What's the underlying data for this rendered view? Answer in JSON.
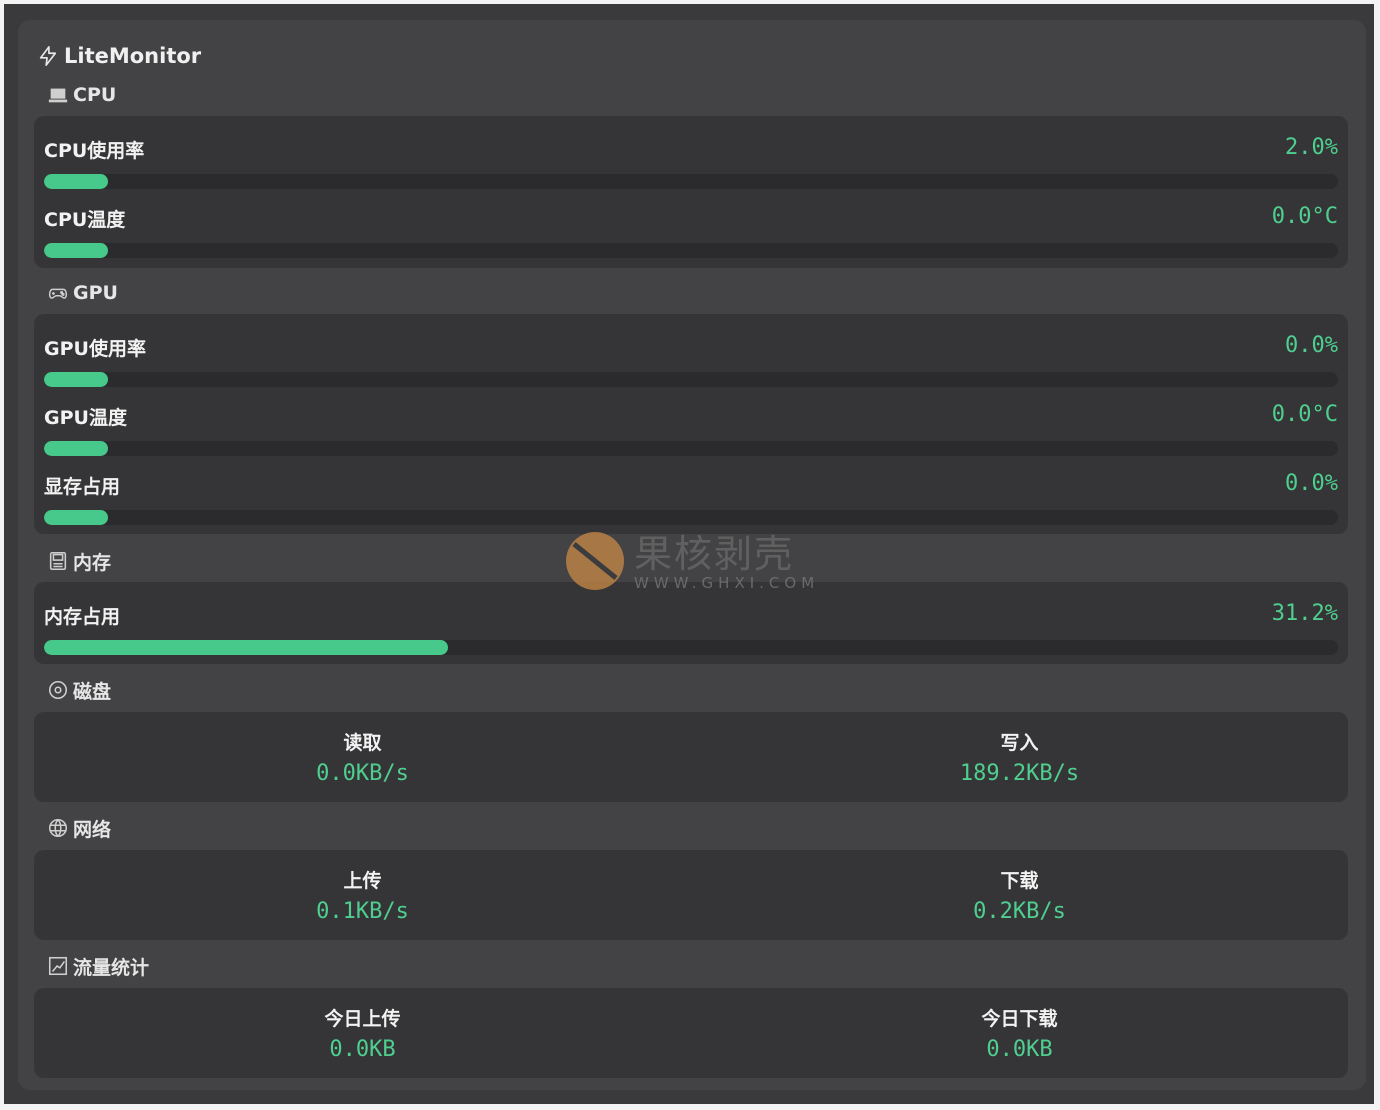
{
  "app": {
    "title": "LiteMonitor",
    "icon": "lightning-icon",
    "accent": "#46c98a"
  },
  "sections": {
    "cpu": {
      "title": "CPU",
      "icon": "laptop-icon",
      "metrics": [
        {
          "label": "CPU使用率",
          "value": "2.0%",
          "level": 0.02
        },
        {
          "label": "CPU温度",
          "value": "0.0°C",
          "level": 0.0
        }
      ]
    },
    "gpu": {
      "title": "GPU",
      "icon": "gamepad-icon",
      "metrics": [
        {
          "label": "GPU使用率",
          "value": "0.0%",
          "level": 0.0
        },
        {
          "label": "GPU温度",
          "value": "0.0°C",
          "level": 0.0
        },
        {
          "label": "显存占用",
          "value": "0.0%",
          "level": 0.0
        }
      ]
    },
    "memory": {
      "title": "内存",
      "icon": "memory-icon",
      "metrics": [
        {
          "label": "内存占用",
          "value": "31.2%",
          "level": 0.312
        }
      ]
    },
    "disk": {
      "title": "磁盘",
      "icon": "disk-icon",
      "read": {
        "label": "读取",
        "value": "0.0KB/s"
      },
      "write": {
        "label": "写入",
        "value": "189.2KB/s"
      }
    },
    "network": {
      "title": "网络",
      "icon": "globe-icon",
      "upload": {
        "label": "上传",
        "value": "0.1KB/s"
      },
      "download": {
        "label": "下载",
        "value": "0.2KB/s"
      }
    },
    "traffic": {
      "title": "流量统计",
      "icon": "chart-icon",
      "today_upload": {
        "label": "今日上传",
        "value": "0.0KB"
      },
      "today_download": {
        "label": "今日下载",
        "value": "0.0KB"
      }
    }
  },
  "watermark": {
    "cn": "果核剥壳",
    "en": "WWW.GHXI.COM"
  }
}
